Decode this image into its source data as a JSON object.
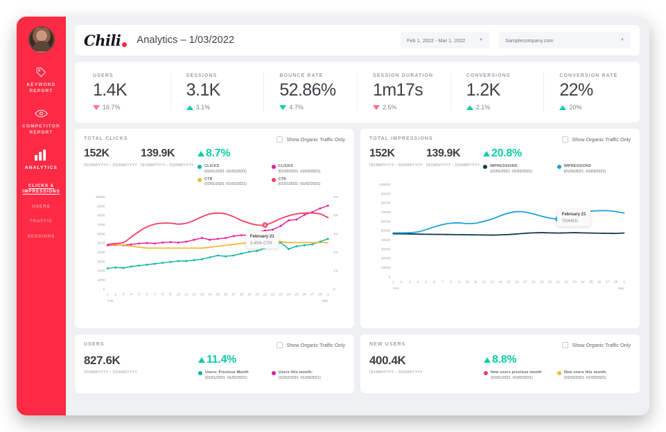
{
  "sidebar": {
    "avatar_name": "user-avatar",
    "nav": [
      {
        "icon": "tag-icon",
        "label": "KEYWORD\nREPORT",
        "active": false
      },
      {
        "icon": "eye-icon",
        "label": "COMPETITOR\nREPORT",
        "active": false
      },
      {
        "icon": "bar-chart-icon",
        "label": "ANALYTICS",
        "active": true
      }
    ],
    "sub_items": [
      {
        "label": "CLICKS &\nIMPRESSIONS",
        "current": true
      },
      {
        "label": "USERS",
        "current": false
      },
      {
        "label": "TRAFFIC",
        "current": false
      },
      {
        "label": "SESSIONS",
        "current": false
      }
    ]
  },
  "header": {
    "logo": "Chili",
    "title": "Analytics – 1/03/2022",
    "date_range": "Feb 1, 2022 - Mar 1, 2022",
    "site": "Samplecompany.com",
    "caret": "▼"
  },
  "kpis": [
    {
      "label": "USERS",
      "value": "1.4K",
      "delta": "16.7%",
      "dir": "down",
      "good": false
    },
    {
      "label": "SESSIONS",
      "value": "3.1K",
      "delta": "3.1%",
      "dir": "up",
      "good": true
    },
    {
      "label": "BOUNCE RATE",
      "value": "52.86%",
      "delta": "4.7%",
      "dir": "down",
      "good": true
    },
    {
      "label": "SESSION DURATION",
      "value": "1m17s",
      "delta": "2.5%",
      "dir": "down",
      "good": false
    },
    {
      "label": "CONVERSIONS",
      "value": "1.2K",
      "delta": "2.1%",
      "dir": "up",
      "good": true
    },
    {
      "label": "CONVERSION RATE",
      "value": "22%",
      "delta": "20%",
      "dir": "up",
      "good": true
    }
  ],
  "checkbox_label": "Show Organic Traffic Only",
  "cards": {
    "clicks": {
      "title": "TOTAL CLICKS",
      "stat1": "152K",
      "range1": "DD/MM/YYYY –\nDD/MM/YYYY",
      "stat2": "139.9K",
      "range2": "DD/MM/YYYY –\nDD/MM/YYYY",
      "pct": "8.7%",
      "legend": [
        {
          "name": "CLICKS",
          "range": "(01/01/2021 -01/02/2021)",
          "color": "#0ab3a3"
        },
        {
          "name": "CLICKS",
          "range": "(01/02/2021 -01/03/2021)",
          "color": "#e5189c"
        },
        {
          "name": "CTR",
          "range": "(01/01/2021 -01/02/2021)",
          "color": "#f5b731"
        },
        {
          "name": "CTR",
          "range": "(01/01/2021 -01/02/2021)",
          "color": "#ef3d5e"
        }
      ],
      "tooltip": {
        "date": "February 21",
        "value": "3.45% CTR"
      }
    },
    "impressions": {
      "title": "TOTAL IMPRESSIONS",
      "stat1": "152K",
      "range1": "DD/MM/YYYY –\nDD/MM/YYYY",
      "stat2": "139.9K",
      "range2": "DD/MM/YYYY –\nDD/MM/YYYY",
      "pct": "20.8%",
      "legend": [
        {
          "name": "IMPRESSIONS",
          "range": "(01/01/2021 -01/02/2021)",
          "color": "#0e3a47"
        },
        {
          "name": "IMPRESSIONS",
          "range": "(01/02/2021 -01/03/2021)",
          "color": "#1b9fd8"
        }
      ],
      "tooltip": {
        "date": "February 21",
        "value": "700HKD"
      }
    },
    "users": {
      "title": "USERS",
      "stat": "827.6K",
      "range": "DD/MM/YYYY – DD/MM/YYYY",
      "pct": "11.4%",
      "legend": [
        {
          "name": "Users: Previous Month",
          "range": "(01/01/2021 -01/02/2021)",
          "color": "#0ab3a3"
        },
        {
          "name": "Users this month:",
          "range": "(01/02/2021 -01/03/2021)",
          "color": "#e5189c"
        }
      ]
    },
    "new_users": {
      "title": "NEW USERS",
      "stat": "400.4K",
      "range": "DD/MM/YYYY – DD/MM/YYYY",
      "pct": "8.8%",
      "legend": [
        {
          "name": "New users previous month",
          "range": "(01/01/2021 -01/02/2021)",
          "color": "#ef3d5e"
        },
        {
          "name": "New users this month.",
          "range": "(01/02/2021 -01/03/2021)",
          "color": "#f5b731"
        }
      ]
    }
  },
  "chart_data": [
    {
      "type": "line",
      "id": "total-clicks",
      "title": "TOTAL CLICKS",
      "xlabel": "",
      "ylabel": "",
      "x": [
        1,
        2,
        3,
        4,
        5,
        6,
        7,
        8,
        9,
        10,
        11,
        12,
        13,
        14,
        15,
        16,
        17,
        18,
        19,
        20,
        21,
        22,
        23,
        24,
        25,
        26,
        27,
        28,
        29
      ],
      "xticks": [
        "1",
        "2",
        "3",
        "4",
        "5",
        "6",
        "7",
        "8",
        "9",
        "10",
        "11",
        "12",
        "13",
        "14",
        "15",
        "16",
        "17",
        "18",
        "19",
        "20",
        "21",
        "22",
        "23",
        "24",
        "25",
        "26",
        "27",
        "28",
        "1"
      ],
      "xaxis_start_label": "Feb",
      "xaxis_end_label": "Mar",
      "ylim": [
        0,
        10000
      ],
      "yticks": [
        0,
        1000,
        2000,
        3000,
        4000,
        5000,
        6000,
        7000,
        8000,
        9000,
        10000
      ],
      "y2lim": [
        0,
        5
      ],
      "y2ticks": [
        "0",
        "1%",
        "2%",
        "3%",
        "4%",
        "5%"
      ],
      "grid": false,
      "legend_position": "top",
      "series": [
        {
          "name": "CLICKS (01/01/2021 -01/02/2021)",
          "axis": "left",
          "color": "#0ab3a3",
          "markers": true,
          "values": [
            2200,
            2300,
            2250,
            2400,
            2500,
            2600,
            2700,
            2800,
            2900,
            3000,
            3000,
            3100,
            3200,
            3400,
            3600,
            3500,
            3600,
            3800,
            4000,
            4100,
            4400,
            4700,
            5000,
            4300,
            4600,
            4700,
            4800,
            5100,
            5400
          ]
        },
        {
          "name": "CLICKS (01/02/2021 -01/03/2021)",
          "axis": "left",
          "color": "#e5189c",
          "markers": true,
          "values": [
            4700,
            4750,
            4700,
            4800,
            4900,
            4950,
            4900,
            5000,
            5050,
            5000,
            5100,
            5300,
            5500,
            5300,
            5400,
            5500,
            5700,
            5800,
            5800,
            6100,
            6300,
            6400,
            6800,
            7400,
            7500,
            8000,
            8300,
            8700,
            9000
          ]
        },
        {
          "name": "CTR (01/01/2021 -01/02/2021)",
          "axis": "right",
          "color": "#f5b731",
          "markers": false,
          "values": [
            2.4,
            2.4,
            2.35,
            2.3,
            2.25,
            2.2,
            2.2,
            2.2,
            2.2,
            2.2,
            2.2,
            2.2,
            2.2,
            2.25,
            2.3,
            2.35,
            2.4,
            2.45,
            2.5,
            2.55,
            2.6,
            2.6,
            2.55,
            2.5,
            2.5,
            2.5,
            2.5,
            2.5,
            2.5
          ]
        },
        {
          "name": "CTR (01/01/2021 -01/02/2021)",
          "axis": "right",
          "color": "#ef3d5e",
          "markers": false,
          "values": [
            2.4,
            2.45,
            2.5,
            2.8,
            3.1,
            3.35,
            3.5,
            3.55,
            3.55,
            3.5,
            3.55,
            3.7,
            3.9,
            4.05,
            4.1,
            4.05,
            3.9,
            3.7,
            3.55,
            3.45,
            3.45,
            3.6,
            3.8,
            3.95,
            4.05,
            4.1,
            4.1,
            4.05,
            3.85
          ]
        }
      ],
      "annotation": {
        "x": 21,
        "date": "February 21",
        "value": "3.45% CTR",
        "series": "CTR"
      }
    },
    {
      "type": "line",
      "id": "total-impressions",
      "title": "TOTAL IMPRESSIONS",
      "x": [
        1,
        2,
        3,
        4,
        5,
        6,
        7,
        8,
        9,
        10,
        11,
        12,
        13,
        14,
        15,
        16,
        17,
        18,
        19,
        20,
        21,
        22,
        23,
        24,
        25,
        26,
        27,
        28,
        29
      ],
      "xticks": [
        "1",
        "2",
        "3",
        "4",
        "5",
        "6",
        "7",
        "8",
        "9",
        "10",
        "11",
        "12",
        "13",
        "14",
        "15",
        "16",
        "17",
        "18",
        "19",
        "20",
        "21",
        "22",
        "23",
        "24",
        "25",
        "26",
        "27",
        "28",
        "1"
      ],
      "xaxis_start_label": "Feb",
      "xaxis_end_label": "Mar",
      "ylim": [
        0,
        100000
      ],
      "yticks": [
        0,
        10000,
        20000,
        30000,
        40000,
        50000,
        60000,
        70000,
        80000,
        90000,
        100000
      ],
      "grid": false,
      "legend_position": "top",
      "series": [
        {
          "name": "IMPRESSIONS (01/01/2021 -01/02/2021)",
          "color": "#0e3a47",
          "markers": false,
          "values": [
            46000,
            46000,
            45800,
            45600,
            45500,
            45400,
            45300,
            45200,
            45000,
            44900,
            44800,
            44700,
            44600,
            44800,
            45200,
            45800,
            46500,
            47000,
            47200,
            47000,
            46800,
            47000,
            47200,
            47000,
            46800,
            46600,
            46500,
            46400,
            46800
          ]
        },
        {
          "name": "IMPRESSIONS (01/02/2021 -01/03/2021)",
          "color": "#1b9fd8",
          "markers": false,
          "values": [
            47000,
            47000,
            47200,
            48000,
            50500,
            53500,
            56000,
            57500,
            57800,
            57000,
            57500,
            59500,
            62000,
            65500,
            68500,
            70000,
            69500,
            67500,
            65000,
            63000,
            62000,
            63500,
            66500,
            69000,
            70500,
            71000,
            71000,
            70000,
            68500
          ]
        }
      ],
      "annotation": {
        "x": 21,
        "date": "February 21",
        "value": "700HKD"
      }
    }
  ]
}
